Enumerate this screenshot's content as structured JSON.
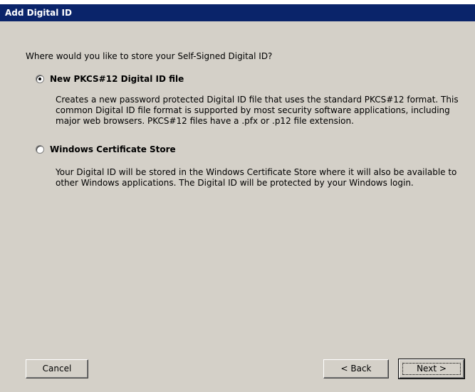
{
  "window": {
    "title": "Add Digital ID"
  },
  "content": {
    "question": "Where would you like to store your Self-Signed Digital ID?",
    "options": [
      {
        "label": "New PKCS#12 Digital ID file",
        "selected": true,
        "description": "Creates a new password protected Digital ID file that uses the standard PKCS#12 format. This common Digital ID file format is supported by most security software applications, including major web browsers. PKCS#12 files have a .pfx or .p12 file extension."
      },
      {
        "label": "Windows Certificate Store",
        "selected": false,
        "description": "Your Digital ID will be stored in the Windows Certificate Store where it will also be available to other Windows applications. The Digital ID will be protected by your Windows login."
      }
    ]
  },
  "buttons": {
    "cancel": "Cancel",
    "back": "< Back",
    "next": "Next >"
  },
  "colors": {
    "titlebar": "#0a246a",
    "dialog_background": "#d4d0c8"
  }
}
